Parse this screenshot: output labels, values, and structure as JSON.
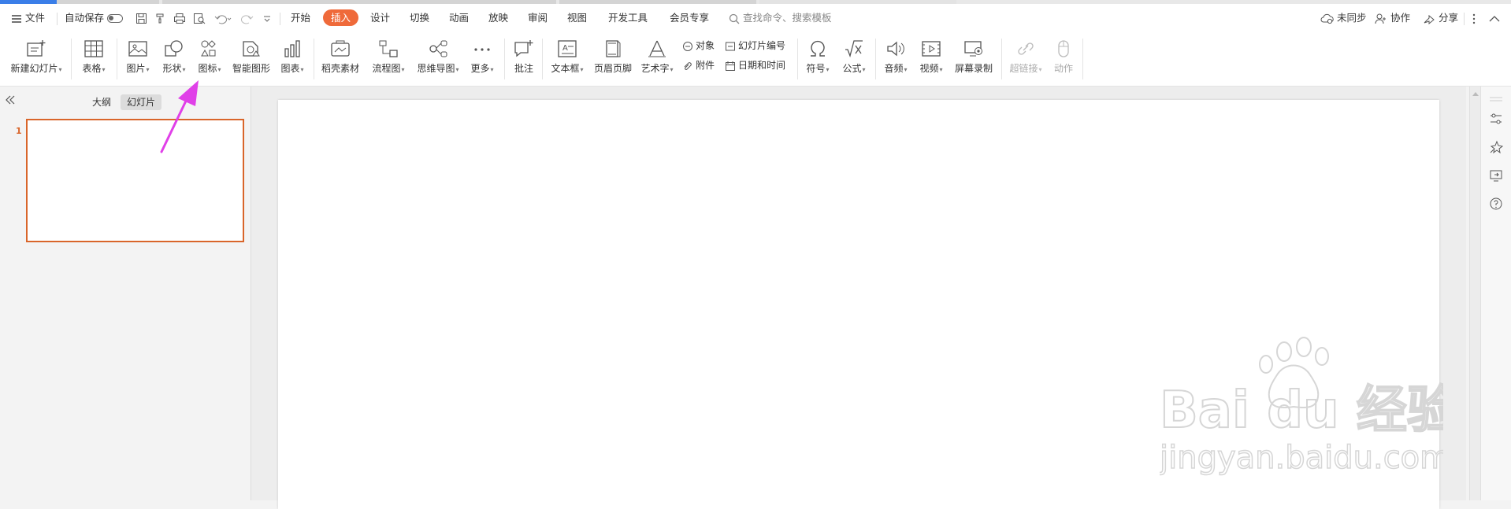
{
  "menubar": {
    "file": "文件",
    "autosave": "自动保存",
    "tabs": [
      "开始",
      "插入",
      "设计",
      "切换",
      "动画",
      "放映",
      "审阅",
      "视图",
      "开发工具",
      "会员专享"
    ],
    "active_tab": "插入",
    "search_placeholder": "查找命令、搜索模板",
    "sync": "未同步",
    "collab": "协作",
    "share": "分享"
  },
  "ribbon": {
    "new_slide": "新建幻灯片",
    "table": "表格",
    "picture": "图片",
    "shape": "形状",
    "icon": "图标",
    "smart_graphic": "智能图形",
    "chart": "图表",
    "material": "稻壳素材",
    "flowchart": "流程图",
    "mindmap": "思维导图",
    "more": "更多",
    "comment": "批注",
    "textbox": "文本框",
    "header_footer": "页眉页脚",
    "wordart": "艺术字",
    "object": "对象",
    "attachment": "附件",
    "slide_number": "幻灯片编号",
    "datetime": "日期和时间",
    "symbol": "符号",
    "formula": "公式",
    "audio": "音频",
    "video": "视频",
    "screen_record": "屏幕录制",
    "hyperlink": "超链接",
    "action": "动作"
  },
  "leftpanel": {
    "tab_outline": "大纲",
    "tab_slides": "幻灯片",
    "slide_number": "1"
  },
  "watermark": {
    "brand": "Bai du 经验",
    "url": "jingyan.baidu.com"
  },
  "colors": {
    "accent": "#ef6a3a",
    "annotation_arrow": "#e040e8",
    "selection_border": "#d9652a"
  }
}
